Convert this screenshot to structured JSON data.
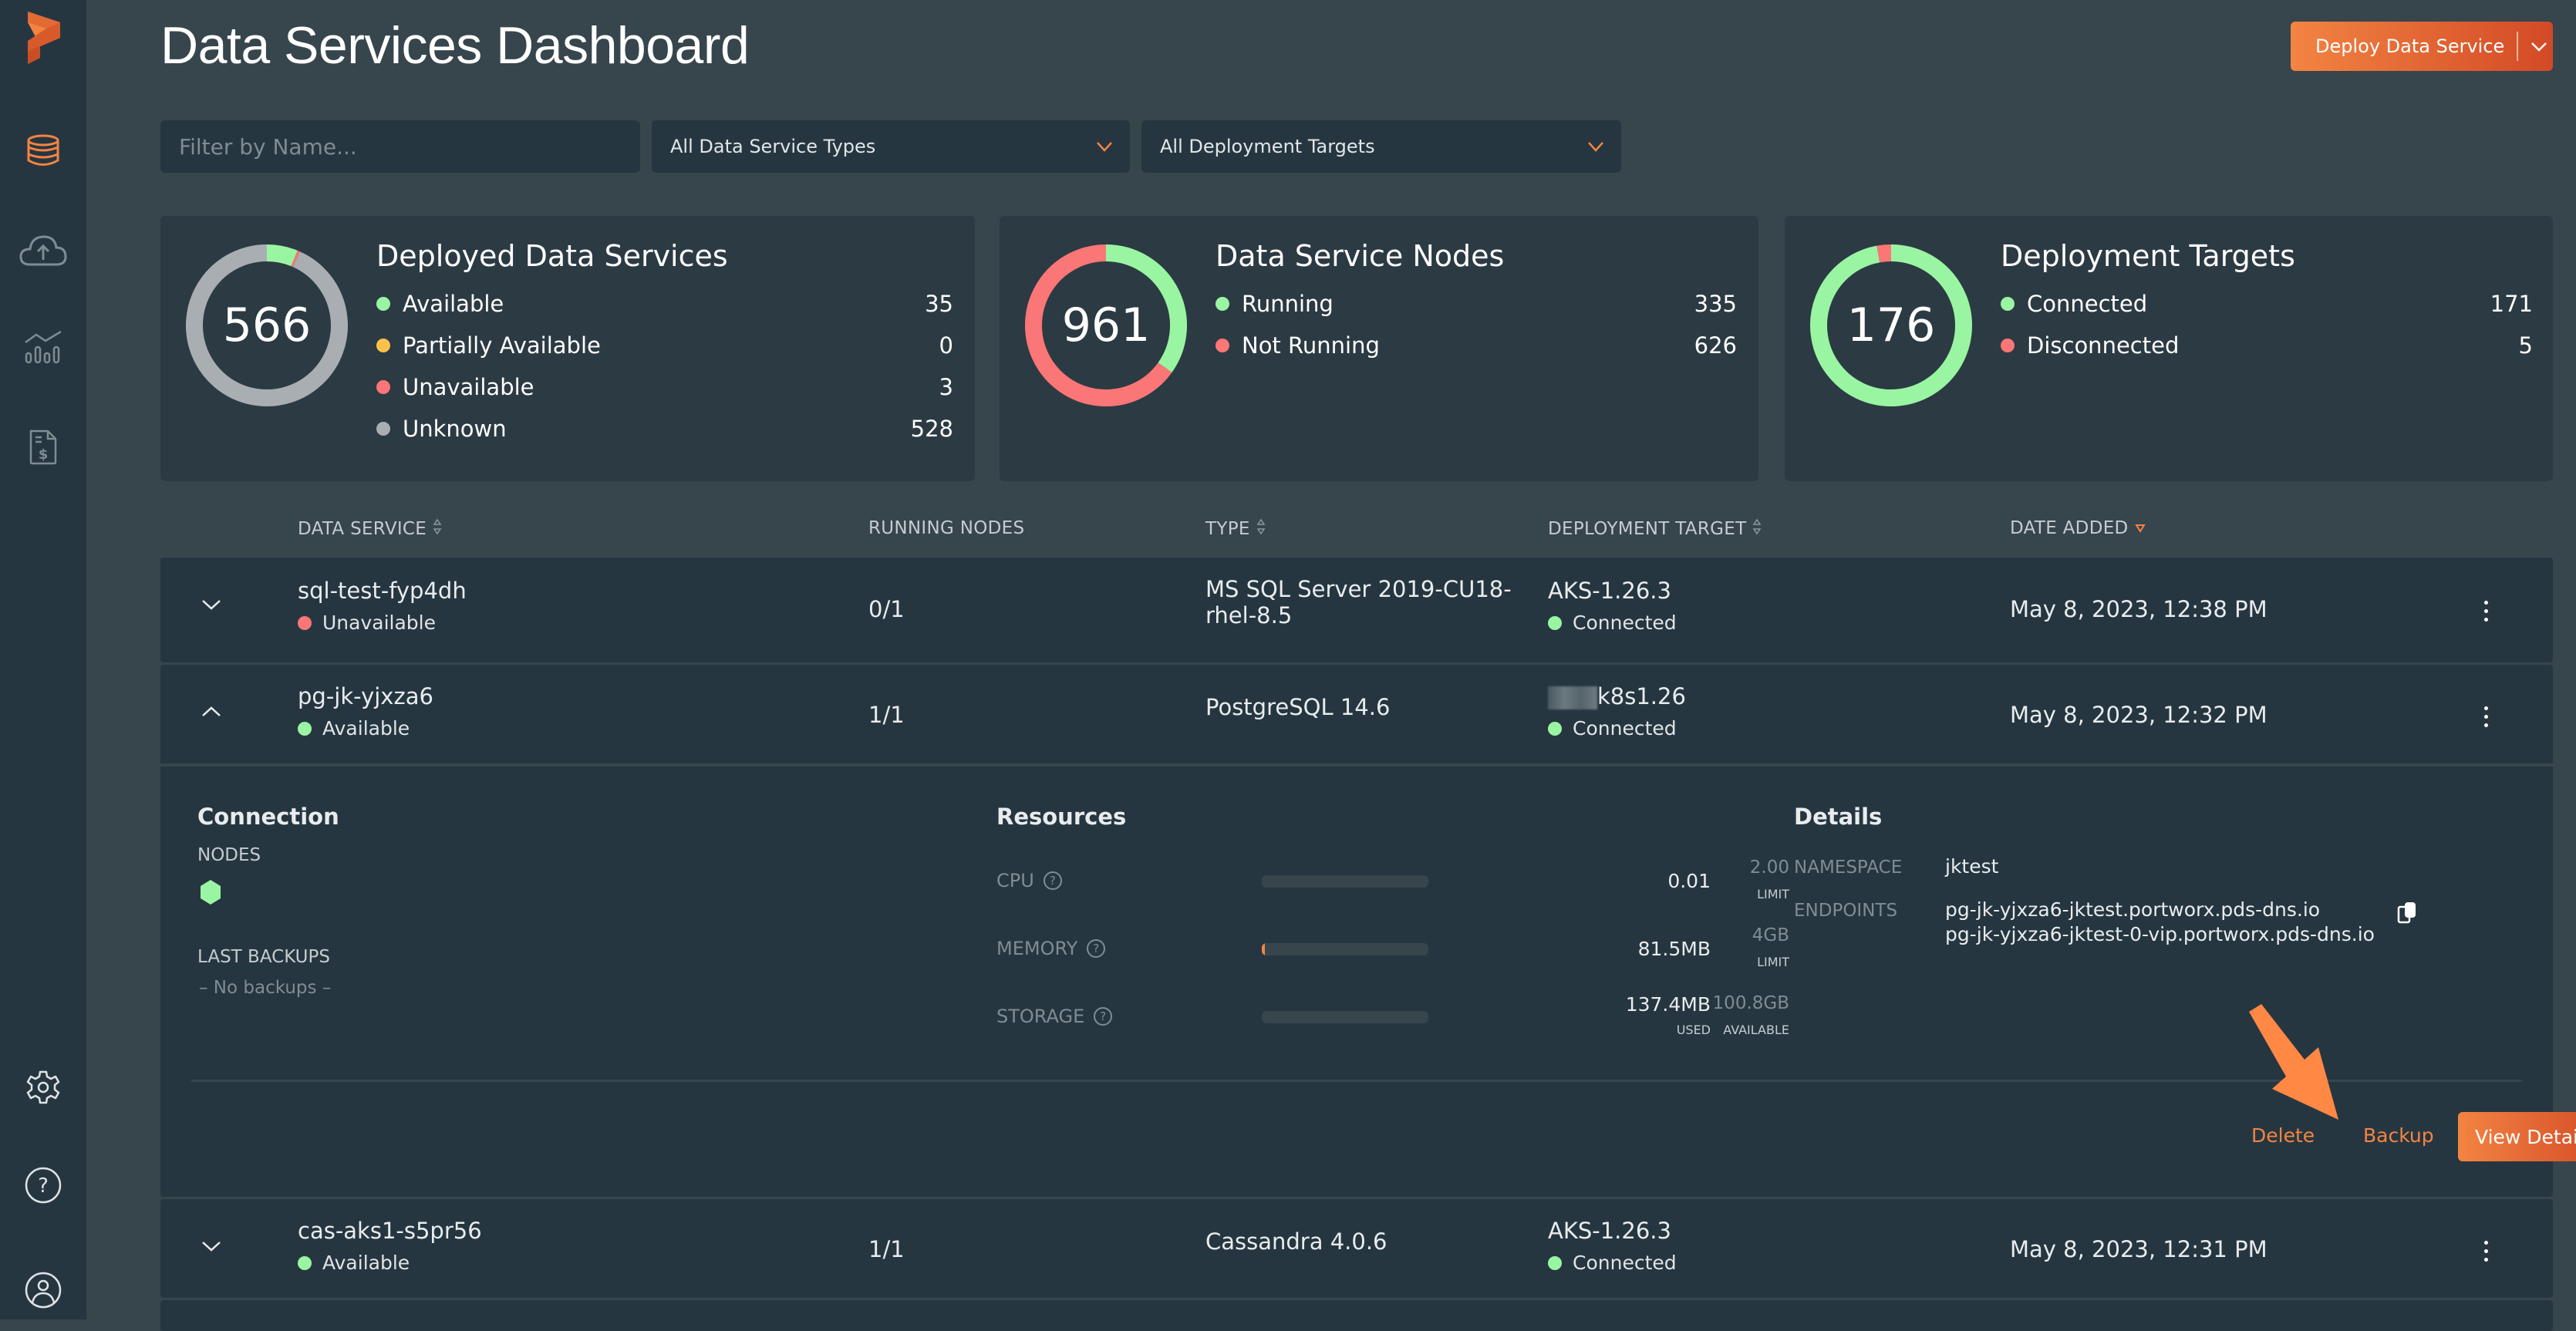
{
  "app": {
    "title": "Data Services Dashboard"
  },
  "sidebar": {
    "items": [
      {
        "name": "logo",
        "icon": "portworx-logo-icon"
      },
      {
        "name": "data-services",
        "icon": "database-icon",
        "active": true
      },
      {
        "name": "backups",
        "icon": "cloud-upload-icon"
      },
      {
        "name": "metrics",
        "icon": "chart-icon"
      },
      {
        "name": "billing",
        "icon": "invoice-dollar-icon"
      },
      {
        "name": "settings",
        "icon": "gear-icon"
      },
      {
        "name": "help",
        "icon": "help-circle-icon"
      },
      {
        "name": "account",
        "icon": "user-circle-icon"
      }
    ]
  },
  "header": {
    "deploy_label": "Deploy Data Service"
  },
  "filters": {
    "name_placeholder": "Filter by Name...",
    "type_selected": "All Data Service Types",
    "target_selected": "All Deployment Targets"
  },
  "colors": {
    "accent": "#f38442",
    "green": "#99f5a2",
    "yellow": "#fbc14a",
    "red": "#fb7676",
    "gray": "#a9aeb2"
  },
  "summary": [
    {
      "title": "Deployed Data Services",
      "total": "566",
      "items": [
        {
          "label": "Available",
          "value": 35,
          "color": "#99f5a2"
        },
        {
          "label": "Partially Available",
          "value": 0,
          "color": "#fbc14a"
        },
        {
          "label": "Unavailable",
          "value": 3,
          "color": "#fb7676"
        },
        {
          "label": "Unknown",
          "value": 528,
          "color": "#a9aeb2"
        }
      ]
    },
    {
      "title": "Data Service Nodes",
      "total": "961",
      "items": [
        {
          "label": "Running",
          "value": 335,
          "color": "#99f5a2"
        },
        {
          "label": "Not Running",
          "value": 626,
          "color": "#fb7676"
        }
      ]
    },
    {
      "title": "Deployment Targets",
      "total": "176",
      "items": [
        {
          "label": "Connected",
          "value": 171,
          "color": "#99f5a2"
        },
        {
          "label": "Disconnected",
          "value": 5,
          "color": "#fb7676"
        }
      ]
    }
  ],
  "table": {
    "headers": [
      "DATA SERVICE",
      "RUNNING NODES",
      "TYPE",
      "DEPLOYMENT TARGET",
      "DATE ADDED"
    ],
    "rows": [
      {
        "name": "sql-test-fyp4dh",
        "status": "Unavailable",
        "running_nodes": "0/1",
        "type_line1": "MS SQL Server 2019-CU18-",
        "type_line2": "rhel-8.5",
        "target": "AKS-1.26.3",
        "target_status": "Connected",
        "date": "May 8, 2023, 12:38 PM"
      },
      {
        "name": "pg-jk-yjxza6",
        "status": "Available",
        "running_nodes": "1/1",
        "type_line1": "PostgreSQL 14.6",
        "target": "k8s1.26",
        "target_status": "Connected",
        "date": "May 8, 2023, 12:32 PM"
      },
      {
        "name": "cas-aks1-s5pr56",
        "status": "Available",
        "running_nodes": "1/1",
        "type_line1": "Cassandra 4.0.6",
        "target": "AKS-1.26.3",
        "target_status": "Connected",
        "date": "May 8, 2023, 12:31 PM"
      }
    ]
  },
  "expanded": {
    "connection_title": "Connection",
    "nodes_label": "NODES",
    "last_backups_label": "LAST BACKUPS",
    "no_backups": "– No backups –",
    "resources_title": "Resources",
    "resources": [
      {
        "label": "CPU",
        "value": "0.01",
        "limit": "2.00",
        "caption_limit": "LIMIT",
        "usage_fraction": 0.005
      },
      {
        "label": "MEMORY",
        "value": "81.5MB",
        "limit": "4GB",
        "caption_limit": "LIMIT",
        "usage_fraction": 0.02
      },
      {
        "label": "STORAGE",
        "value": "137.4MB",
        "limit": "100.8GB",
        "caption_value": "USED",
        "caption_limit": "AVAILABLE",
        "usage_fraction": 0.0013
      }
    ],
    "details_title": "Details",
    "namespace_label": "NAMESPACE",
    "namespace": "jktest",
    "endpoints_label": "ENDPOINTS",
    "endpoint1": "pg-jk-yjxza6-jktest.portworx.pds-dns.io",
    "endpoint2": "pg-jk-yjxza6-jktest-0-vip.portworx.pds-dns.io",
    "delete_label": "Delete",
    "backup_label": "Backup",
    "view_details_label": "View Details"
  }
}
